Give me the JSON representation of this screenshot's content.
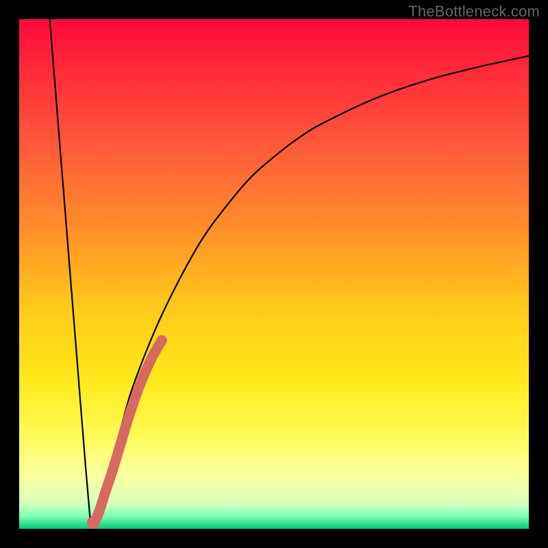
{
  "watermark": "TheBottleneck.com",
  "colors": {
    "frame": "#000000",
    "curve": "#000000",
    "highlight": "#d66a63",
    "gradient_stops": [
      {
        "offset": 0.0,
        "color": "#ff0a3a"
      },
      {
        "offset": 0.1,
        "color": "#ff2a3a"
      },
      {
        "offset": 0.25,
        "color": "#ff5a3a"
      },
      {
        "offset": 0.4,
        "color": "#ff8a2a"
      },
      {
        "offset": 0.55,
        "color": "#ffc41a"
      },
      {
        "offset": 0.7,
        "color": "#ffe81a"
      },
      {
        "offset": 0.8,
        "color": "#fff84a"
      },
      {
        "offset": 0.86,
        "color": "#fdff80"
      },
      {
        "offset": 0.9,
        "color": "#f8ffa0"
      },
      {
        "offset": 0.93,
        "color": "#e8ffb0"
      },
      {
        "offset": 0.955,
        "color": "#c8ffc0"
      },
      {
        "offset": 0.975,
        "color": "#80ffb0"
      },
      {
        "offset": 0.99,
        "color": "#30e090"
      },
      {
        "offset": 1.0,
        "color": "#10c878"
      }
    ]
  },
  "chart_data": {
    "type": "line",
    "title": "",
    "xlabel": "",
    "ylabel": "",
    "xlim": [
      0,
      100
    ],
    "ylim": [
      0,
      100
    ],
    "notes": "V-shaped bottleneck curve. Left branch falls steeply from (≈6,100) to a minimum near (≈14,1). Right branch rises sharply then asymptotically toward ≈93 at x=100. Thick salmon highlight segment overlays the right branch from roughly x≈16 (y≈5) up to x≈28 (y≈37), plus a tiny hook near the trough at x≈14.5–15.5.",
    "series": [
      {
        "name": "left_branch",
        "x": [
          6.0,
          7.0,
          8.0,
          9.0,
          10.0,
          11.0,
          12.0,
          13.0,
          14.0
        ],
        "y": [
          100.0,
          87.5,
          75.0,
          62.6,
          50.0,
          37.6,
          25.0,
          12.6,
          1.0
        ]
      },
      {
        "name": "right_branch",
        "x": [
          14.0,
          15.0,
          16.0,
          18.0,
          20.0,
          22.0,
          25.0,
          28.0,
          32.0,
          36.0,
          40.0,
          45.0,
          50.0,
          55.0,
          60.0,
          70.0,
          80.0,
          90.0,
          100.0
        ],
        "y": [
          1.0,
          3.0,
          6.0,
          13.0,
          20.0,
          27.0,
          35.0,
          42.0,
          50.0,
          57.0,
          62.5,
          68.5,
          73.0,
          76.8,
          79.8,
          84.5,
          88.0,
          90.6,
          92.8
        ]
      },
      {
        "name": "highlight_segment",
        "x": [
          14.3,
          14.8,
          15.4,
          16.0,
          17.0,
          18.5,
          20.0,
          22.0,
          24.0,
          26.0,
          28.0
        ],
        "y": [
          1.3,
          1.6,
          2.6,
          4.3,
          7.5,
          12.0,
          17.0,
          23.5,
          29.0,
          33.5,
          37.0
        ]
      }
    ]
  }
}
